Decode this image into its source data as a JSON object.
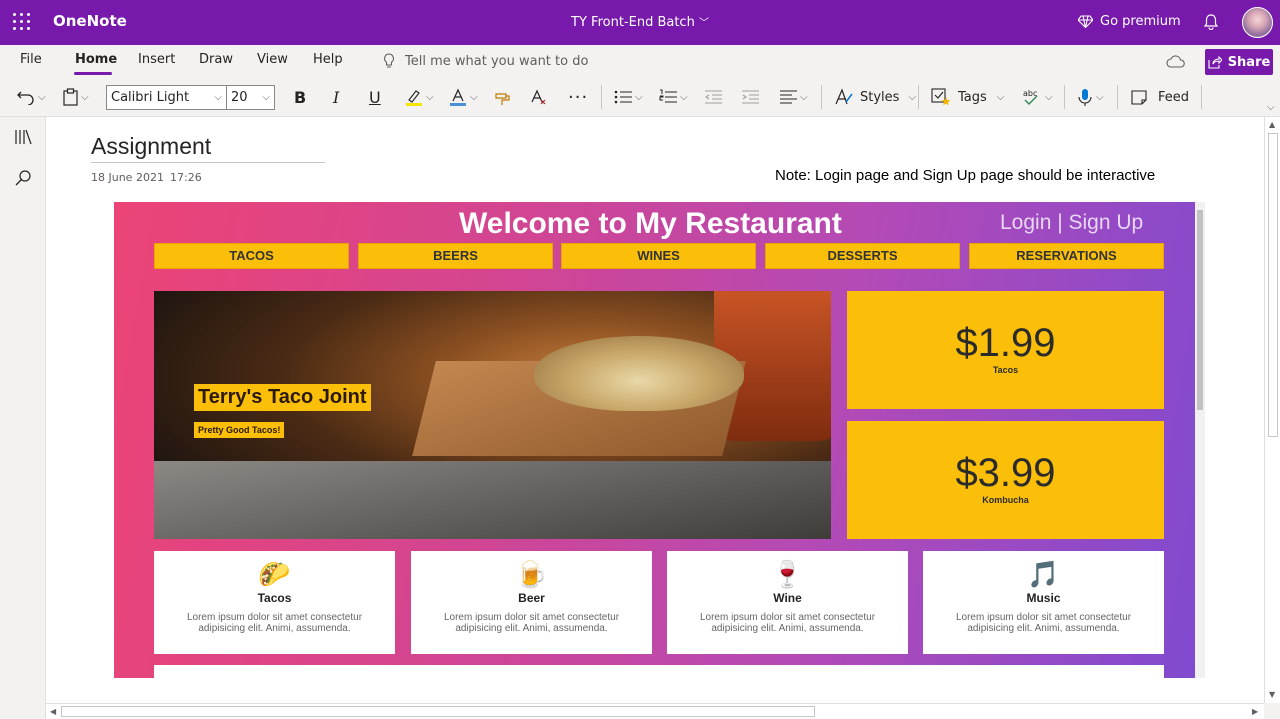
{
  "titlebar": {
    "app_name": "OneNote",
    "notebook": "TY Front-End Batch",
    "premium": "Go premium"
  },
  "menu": {
    "tabs": [
      "File",
      "Home",
      "Insert",
      "Draw",
      "View",
      "Help"
    ],
    "active_tab": "Home",
    "tell_me_placeholder": "Tell me what you want to do",
    "share": "Share"
  },
  "toolbar": {
    "font_name": "Calibri Light",
    "font_size": "20",
    "bold": "B",
    "italic": "I",
    "underline": "U",
    "styles": "Styles",
    "tags": "Tags",
    "feed": "Feed"
  },
  "page": {
    "title": "Assignment",
    "date": "18 June 2021",
    "time": "17:26",
    "note": "Note: Login page and Sign Up page should be interactive"
  },
  "site": {
    "welcome": "Welcome to My Restaurant",
    "login": "Login | Sign Up",
    "nav": [
      "TACOS",
      "BEERS",
      "WINES",
      "DESSERTS",
      "RESERVATIONS"
    ],
    "hero_title": "Terry's Taco Joint",
    "hero_sub": "Pretty Good Tacos!",
    "prices": [
      {
        "price": "$1.99",
        "label": "Tacos"
      },
      {
        "price": "$3.99",
        "label": "Kombucha"
      }
    ],
    "features": [
      {
        "icon": "🌮",
        "icon_name": "taco-icon",
        "name": "Tacos",
        "desc": "Lorem ipsum dolor sit amet consectetur adipisicing elit. Animi, assumenda."
      },
      {
        "icon": "🍺",
        "icon_name": "beer-icon",
        "name": "Beer",
        "desc": "Lorem ipsum dolor sit amet consectetur adipisicing elit. Animi, assumenda."
      },
      {
        "icon": "🍷",
        "icon_name": "wine-icon",
        "name": "Wine",
        "desc": "Lorem ipsum dolor sit amet consectetur adipisicing elit. Animi, assumenda."
      },
      {
        "icon": "🎵",
        "icon_name": "music-icon",
        "name": "Music",
        "desc": "Lorem ipsum dolor sit amet consectetur adipisicing elit. Animi, assumenda."
      }
    ]
  },
  "colors": {
    "brand": "#7719aa",
    "accent_yellow": "#fbbf0a"
  }
}
